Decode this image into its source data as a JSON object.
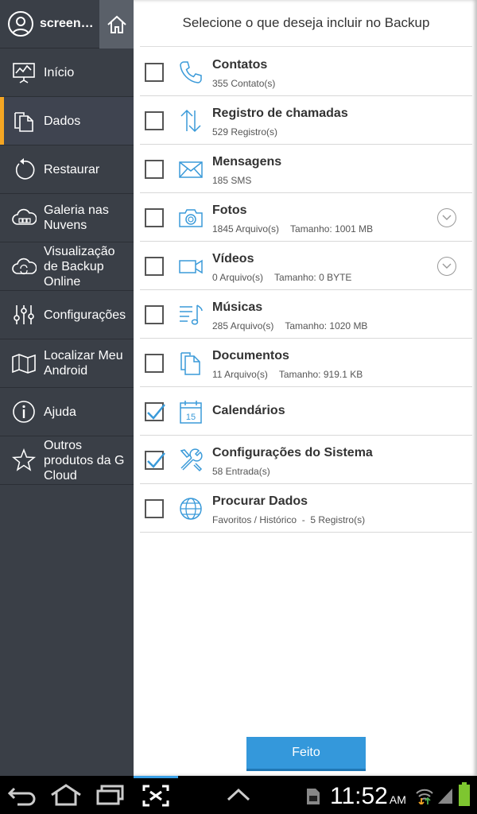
{
  "sidebar": {
    "username": "screens…",
    "items": [
      {
        "label": "Início",
        "icon": "presentation-chart-icon"
      },
      {
        "label": "Dados",
        "icon": "documents-icon",
        "active": true
      },
      {
        "label": "Restaurar",
        "icon": "restore-icon"
      },
      {
        "label": "Galeria nas Nuvens",
        "icon": "cloud-gallery-icon"
      },
      {
        "label": "Visualização de Backup Online",
        "icon": "cloud-sync-icon"
      },
      {
        "label": "Configurações",
        "icon": "sliders-icon"
      },
      {
        "label": "Localizar Meu Android",
        "icon": "map-icon"
      },
      {
        "label": "Ajuda",
        "icon": "info-icon"
      },
      {
        "label": "Outros produtos da G Cloud",
        "icon": "star-icon"
      }
    ]
  },
  "main": {
    "title": "Selecione o que deseja incluir no Backup",
    "rows": [
      {
        "title": "Contatos",
        "sub1": "355 Contato(s)",
        "sub2": "",
        "checked": false,
        "icon": "phone-icon"
      },
      {
        "title": "Registro de chamadas",
        "sub1": "529 Registro(s)",
        "sub2": "",
        "checked": false,
        "icon": "up-down-arrows-icon"
      },
      {
        "title": "Mensagens",
        "sub1": "185 SMS",
        "sub2": "",
        "checked": false,
        "icon": "envelope-icon"
      },
      {
        "title": "Fotos",
        "sub1": "1845 Arquivo(s)",
        "sub2": "Tamanho: 1001 MB",
        "checked": false,
        "icon": "camera-icon",
        "expand": true
      },
      {
        "title": "Vídeos",
        "sub1": "0 Arquivo(s)",
        "sub2": "Tamanho: 0 BYTE",
        "checked": false,
        "icon": "video-camera-icon",
        "expand": true
      },
      {
        "title": "Músicas",
        "sub1": "285 Arquivo(s)",
        "sub2": "Tamanho: 1020 MB",
        "checked": false,
        "icon": "music-list-icon"
      },
      {
        "title": "Documentos",
        "sub1": "11 Arquivo(s)",
        "sub2": "Tamanho: 919.1 KB",
        "checked": false,
        "icon": "document-icon"
      },
      {
        "title": "Calendários",
        "sub1": "",
        "sub2": "",
        "checked": true,
        "icon": "calendar-icon",
        "cal_day": "15"
      },
      {
        "title": "Configurações do Sistema",
        "sub1": "58 Entrada(s)",
        "sub2": "",
        "checked": true,
        "icon": "tools-icon"
      },
      {
        "title": "Procurar Dados",
        "sub1": "Favoritos / Histórico",
        "sub2": "5 Registro(s)",
        "checked": false,
        "icon": "globe-icon",
        "dash": "-"
      }
    ],
    "done_label": "Feito"
  },
  "statusbar": {
    "time": "11:52",
    "ampm": "AM"
  },
  "colors": {
    "sidebar_bg": "#3a3f47",
    "accent": "#f5a623",
    "icon_blue": "#3a9ad9",
    "button_blue": "#3498db"
  }
}
